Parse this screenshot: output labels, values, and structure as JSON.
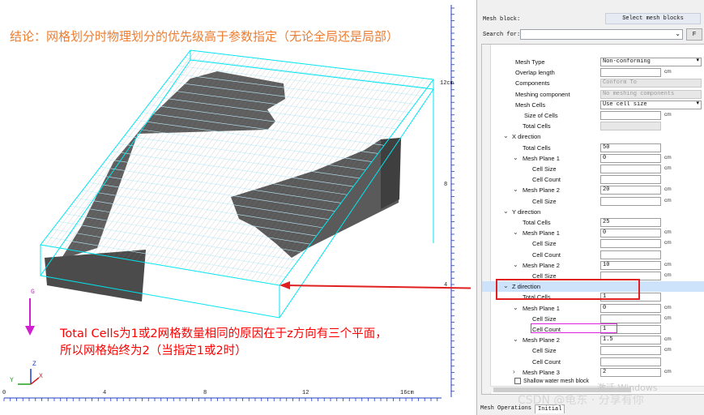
{
  "viewport": {
    "conclusion_note": "结论：网格划分时物理划分的优先级高于参数指定（无论全局还是局部）",
    "explain_line1": "Total Cells为1或2网格数量相同的原因在于z方向有三个平面，",
    "explain_line2": "所以网格始终为2（当指定1或2时）",
    "axis_g": "G",
    "triad_z": "Z",
    "triad_y": "Y",
    "triad_x": "X",
    "bottom_ticks": [
      "0",
      "4",
      "8",
      "12",
      "16cm"
    ],
    "right_ticks": [
      "12cm",
      "8",
      "4"
    ],
    "colors": {
      "orange": "#ed7d31",
      "red": "#ff0000",
      "cyan": "#00e5f0",
      "mesh_gray": "#5b5b5b",
      "ruler_blue": "#1f3fbf",
      "magenta": "#d020d0"
    }
  },
  "panel": {
    "mesh_block_label": "Mesh block:",
    "select_blocks_label": "Select  mesh blocks",
    "search_label": "Search for:",
    "search_value": "",
    "search_arrow": "⌄",
    "small_button": "F",
    "rows": [
      {
        "label": "Mesh Type",
        "value": "Non-conforming",
        "kind": "dropdown"
      },
      {
        "label": "Overlap length",
        "value": "",
        "kind": "field",
        "unit": "cm"
      },
      {
        "label": "Components",
        "value": "Conform To",
        "kind": "disabled"
      },
      {
        "label": "Meshing component",
        "value": "No meshing components",
        "kind": "disabled"
      },
      {
        "label": "Mesh Cells",
        "value": "Use cell size",
        "kind": "dropdown"
      },
      {
        "label": "Size of Cells",
        "value": "",
        "kind": "field",
        "unit": "cm"
      },
      {
        "label": "Total Cells",
        "value": "",
        "kind": "disabled-small"
      },
      {
        "label": "X direction",
        "kind": "group"
      },
      {
        "label": "Total Cells",
        "value": "50",
        "kind": "field"
      },
      {
        "label": "Mesh Plane 1",
        "value": "0",
        "kind": "field",
        "unit": "cm",
        "chev": true
      },
      {
        "label": "Cell Size",
        "value": "",
        "kind": "field",
        "unit": "cm"
      },
      {
        "label": "Cell Count",
        "value": "",
        "kind": "field"
      },
      {
        "label": "Mesh Plane 2",
        "value": "20",
        "kind": "field",
        "unit": "cm",
        "chev": true
      },
      {
        "label": "Cell Size",
        "value": "",
        "kind": "field",
        "unit": "cm"
      },
      {
        "label": "Y direction",
        "kind": "group"
      },
      {
        "label": "Total Cells",
        "value": "25",
        "kind": "field"
      },
      {
        "label": "Mesh Plane 1",
        "value": "0",
        "kind": "field",
        "unit": "cm",
        "chev": true
      },
      {
        "label": "Cell Size",
        "value": "",
        "kind": "field",
        "unit": "cm"
      },
      {
        "label": "Cell Count",
        "value": "",
        "kind": "field"
      },
      {
        "label": "Mesh Plane 2",
        "value": "10",
        "kind": "field",
        "unit": "cm",
        "chev": true
      },
      {
        "label": "Cell Size",
        "value": "",
        "kind": "field",
        "unit": "cm"
      },
      {
        "label": "Z direction",
        "kind": "group",
        "selected": true
      },
      {
        "label": "Total Cells",
        "value": "1",
        "kind": "field"
      },
      {
        "label": "Mesh Plane 1",
        "value": "0",
        "kind": "field",
        "unit": "cm",
        "chev": true
      },
      {
        "label": "Cell Size",
        "value": "",
        "kind": "field",
        "unit": "cm"
      },
      {
        "label": "Cell Count",
        "value": "1",
        "kind": "field"
      },
      {
        "label": "Mesh Plane 2",
        "value": "1.5",
        "kind": "field",
        "unit": "cm",
        "chev": true
      },
      {
        "label": "Cell Size",
        "value": "",
        "kind": "field",
        "unit": "cm"
      },
      {
        "label": "Cell Count",
        "value": "",
        "kind": "field"
      },
      {
        "label": "Mesh Plane 3",
        "value": "2",
        "kind": "field",
        "unit": "cm",
        "chev": true,
        "collapsed": true
      }
    ],
    "shallow_water_label": "Shallow water mesh block",
    "tabs": [
      "Mesh Operations",
      "Initial"
    ],
    "windows_mark": "激活 Windows",
    "watermark": "CSDN @龟东 · 分享有你"
  }
}
